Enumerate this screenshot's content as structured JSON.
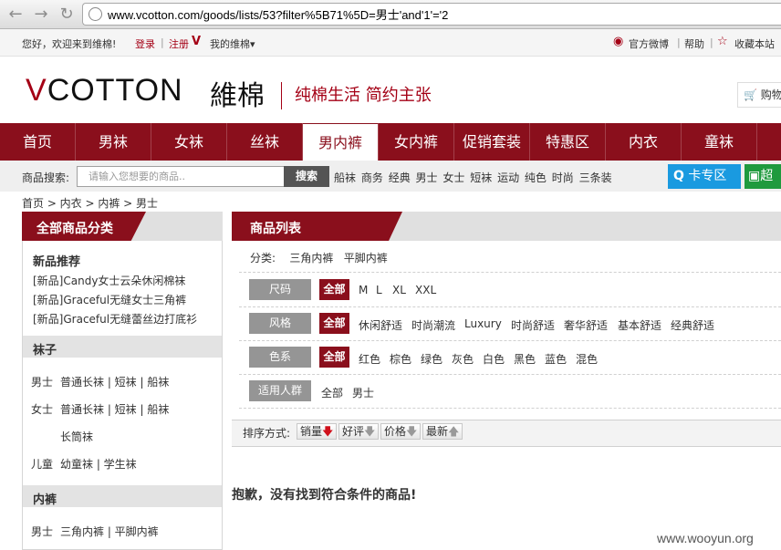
{
  "browser": {
    "url": "www.vcotton.com/goods/lists/53?filter%5B71%5D=男士'and'1'='2"
  },
  "topbar": {
    "welcome": "您好，欢迎来到维棉!",
    "login": "登录",
    "register": "注册",
    "my_vcotton": "我的维棉",
    "weibo": "官方微博",
    "help": "帮助",
    "favorite": "收藏本站"
  },
  "header": {
    "logo_v": "V",
    "logo_rest": "COTTON",
    "logo_cn": "維棉",
    "slogan": "纯棉生活 简约主张",
    "cart_label": "购物"
  },
  "mainnav": [
    "首页",
    "男袜",
    "女袜",
    "丝袜",
    "男内裤",
    "女内裤",
    "促销套装",
    "特惠区",
    "内衣",
    "童袜"
  ],
  "search": {
    "label": "商品搜索:",
    "placeholder": "请输入您想要的商品..",
    "button": "搜索",
    "keywords": [
      "船袜",
      "商务",
      "经典",
      "男士",
      "女士",
      "短袜",
      "运动",
      "纯色",
      "时尚",
      "三条装"
    ],
    "card_zone": "卡专区",
    "card_zone2": "超"
  },
  "breadcrumb": "首页 > 内衣 > 内裤 > 男士",
  "sidebar": {
    "title": "全部商品分类",
    "new_title": "新品推荐",
    "new_items": [
      "[新品]Candy女士云朵休闲棉袜",
      "[新品]Graceful无缝女士三角裤",
      "[新品]Graceful无缝蕾丝边打底衫"
    ],
    "socks_title": "袜子",
    "men_label": "男士",
    "men_items": "普通长袜 | 短袜 | 船袜",
    "women_label": "女士",
    "women_items": "普通长袜 | 短袜 | 船袜",
    "women_extra": "长筒袜",
    "kids_label": "儿童",
    "kids_items": "幼童袜 | 学生袜",
    "underwear_title": "内裤",
    "uw_men_label": "男士",
    "uw_men_items": "三角内裤 | 平脚内裤"
  },
  "product": {
    "title": "商品列表",
    "category_label": "分类:",
    "categories": [
      "三角内裤",
      "平脚内裤"
    ],
    "filters": [
      {
        "label": "尺码",
        "all": "全部",
        "options": [
          "M",
          "L",
          "XL",
          "XXL"
        ]
      },
      {
        "label": "风格",
        "all": "全部",
        "options": [
          "休闲舒适",
          "时尚潮流",
          "Luxury",
          "时尚舒适",
          "奢华舒适",
          "基本舒适",
          "经典舒适"
        ]
      },
      {
        "label": "色系",
        "all": "全部",
        "options": [
          "红色",
          "棕色",
          "绿色",
          "灰色",
          "白色",
          "黑色",
          "蓝色",
          "混色"
        ]
      },
      {
        "label": "适用人群",
        "options": [
          "全部",
          "男士"
        ]
      }
    ],
    "sort_label": "排序方式:",
    "sort": [
      "销量",
      "好评",
      "价格",
      "最新"
    ],
    "empty_message": "抱歉，没有找到符合条件的商品!"
  },
  "watermark": "www.wooyun.org"
}
